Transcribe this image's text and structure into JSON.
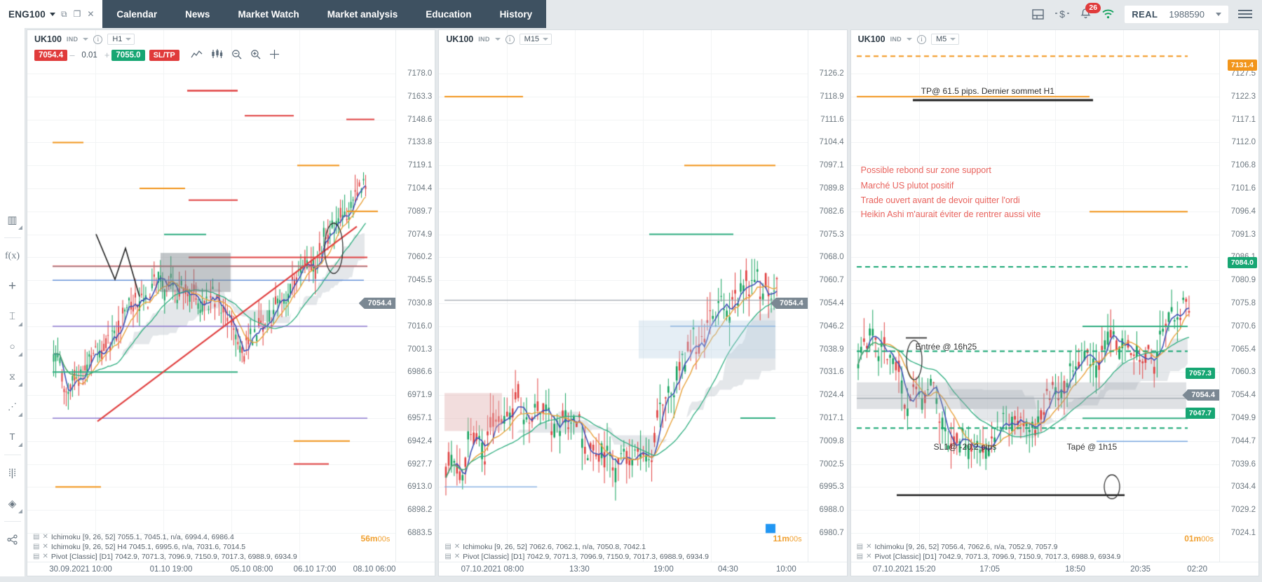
{
  "topbar": {
    "symbol_tab": "ENG100",
    "window_icons": [
      "restore-icon",
      "maximize-icon",
      "close-icon"
    ],
    "nav": [
      {
        "label": "Calendar",
        "name": "nav-calendar"
      },
      {
        "label": "News",
        "name": "nav-news"
      },
      {
        "label": "Market Watch",
        "name": "nav-market-watch"
      },
      {
        "label": "Market analysis",
        "name": "nav-market-analysis"
      },
      {
        "label": "Education",
        "name": "nav-education"
      },
      {
        "label": "History",
        "name": "nav-history"
      }
    ],
    "notification_count": "26",
    "account_type": "REAL",
    "account_number": "1988590"
  },
  "left_tools": [
    {
      "name": "indicators-bars-icon",
      "glyph": "▥"
    },
    {
      "name": "function-icon",
      "glyph": "f(x)"
    },
    {
      "name": "add-plus-icon",
      "glyph": "+"
    },
    {
      "name": "vertical-line-icon",
      "glyph": "⌶"
    },
    {
      "name": "circle-shape-icon",
      "glyph": "○"
    },
    {
      "name": "fibonacci-icon",
      "glyph": "⧖"
    },
    {
      "name": "pitchfork-icon",
      "glyph": "⋰"
    },
    {
      "name": "text-tool-icon",
      "glyph": "T"
    },
    {
      "name": "candle-type-icon",
      "glyph": "⦙"
    },
    {
      "name": "layers-icon",
      "glyph": "◈"
    },
    {
      "name": "share-icon",
      "glyph": "⦝"
    }
  ],
  "charts": [
    {
      "name": "chart-h1",
      "symbol": "UK100",
      "ind_label": "IND",
      "timeframe": "H1",
      "order": {
        "bid": "7054.4",
        "volume": "0.01",
        "ask": "7055.0",
        "sltp": "SL/TP",
        "minus": "–",
        "plus": "+"
      },
      "toolbar_icons": [
        "line-chart-icon",
        "candles-icon",
        "zoom-out-icon",
        "zoom-in-icon",
        "crosshair-icon"
      ],
      "y_ticks": [
        "7178.0",
        "7163.3",
        "7148.6",
        "7133.8",
        "7119.1",
        "7104.4",
        "7089.7",
        "7074.9",
        "7060.2",
        "7045.5",
        "7030.8",
        "7016.0",
        "7001.3",
        "6986.6",
        "6971.9",
        "6957.1",
        "6942.4",
        "6927.7",
        "6913.0",
        "6898.2",
        "6883.5"
      ],
      "current_price": "7054.4",
      "time_ticks": [
        "30.09.2021 10:00",
        "01.10 19:00",
        "05.10 08:00",
        "06.10 17:00",
        "08.10 06:00"
      ],
      "countdown_min": "56m",
      "countdown_sec": "00s",
      "legend": [
        "Ichimoku [9, 26, 52] 7055.1, 7045.1, n/a, 6994.4, 6986.4",
        "Ichimoku [9, 26, 52] H4 7045.1, 6995.6, n/a, 7031.6, 7014.5",
        "Pivot [Classic] [D1] 7042.9, 7071.3, 7096.9, 7150.9, 7017.3, 6988.9, 6934.9"
      ]
    },
    {
      "name": "chart-m15",
      "symbol": "UK100",
      "ind_label": "IND",
      "timeframe": "M15",
      "y_ticks": [
        "7126.2",
        "7118.9",
        "7111.6",
        "7104.4",
        "7097.1",
        "7089.8",
        "7082.6",
        "7075.3",
        "7068.0",
        "7060.7",
        "7054.4",
        "7046.2",
        "7038.9",
        "7031.6",
        "7024.4",
        "7017.1",
        "7009.8",
        "7002.5",
        "6995.3",
        "6988.0",
        "6980.7"
      ],
      "current_price": "7054.4",
      "low_price": "6980.7",
      "time_ticks": [
        "07.10.2021 08:00",
        "13:30",
        "19:00",
        "04:30",
        "10:00"
      ],
      "countdown_min": "11m",
      "countdown_sec": "00s",
      "legend": [
        "Ichimoku [9, 26, 52] 7062.6, 7062.1, n/a, 7050.8, 7042.1",
        "Pivot [Classic] [D1] 7042.9, 7071.3, 7096.9, 7150.9, 7017.3, 6988.9, 6934.9"
      ]
    },
    {
      "name": "chart-m5",
      "symbol": "UK100",
      "ind_label": "IND",
      "timeframe": "M5",
      "y_ticks": [
        "7127.5",
        "7122.3",
        "7117.1",
        "7112.0",
        "7106.8",
        "7101.6",
        "7096.4",
        "7091.3",
        "7086.1",
        "7080.9",
        "7075.8",
        "7070.6",
        "7065.4",
        "7060.3",
        "7054.4",
        "7049.9",
        "7044.7",
        "7039.6",
        "7034.4",
        "7029.2",
        "7024.1"
      ],
      "current_price": "7054.4",
      "badges": [
        {
          "label": "7131.4",
          "color": "#f2951b",
          "name": "tp-badge"
        },
        {
          "label": "7084.0",
          "color": "#17a673",
          "name": "level-badge-7084"
        },
        {
          "label": "7057.3",
          "color": "#17a673",
          "name": "level-badge-7057"
        },
        {
          "label": "7047.7",
          "color": "#17a673",
          "name": "level-badge-7047"
        }
      ],
      "annotations": [
        {
          "text": "TP@ 61.5 pips. Dernier sommet H1",
          "name": "annotation-tp",
          "color": "#333"
        },
        {
          "text": "Possible rebond sur zone support",
          "name": "annotation-rebond",
          "color": "#e8625c"
        },
        {
          "text": " Marché US plutot positif",
          "name": "annotation-marche-us",
          "color": "#e8625c"
        },
        {
          "text": "Trade ouvert avant de devoir quitter l'ordi",
          "name": "annotation-trade-ouvert",
          "color": "#e8625c"
        },
        {
          "text": "Heikin Ashi m'aurait éviter de rentrer aussi vite",
          "name": "annotation-heikin-ashi",
          "color": "#e8625c"
        },
        {
          "text": "Entrée @ 16h25",
          "name": "annotation-entree",
          "color": "#333"
        },
        {
          "text": "SL1@ -20.2 pips",
          "name": "annotation-sl1",
          "color": "#333"
        },
        {
          "text": "Tapé @ 1h15",
          "name": "annotation-tape",
          "color": "#333"
        }
      ],
      "time_ticks": [
        "07.10.2021 15:20",
        "17:05",
        "18:50",
        "20:35",
        "02:20"
      ],
      "countdown_min": "01m",
      "countdown_sec": "00s",
      "legend": [
        "Ichimoku [9, 26, 52] 7056.4, 7062.6, n/a, 7052.9, 7057.9",
        "Pivot [Classic] [D1] 7042.9, 7071.3, 7096.9, 7150.9, 7017.3, 6988.9, 6934.9"
      ]
    }
  ],
  "colors": {
    "nav_bg": "#3e5161",
    "bull": "#16a35f",
    "bear": "#e04040",
    "accent_orange": "#f2951b",
    "accent_green": "#17a673",
    "annotation_red": "#e8625c",
    "tenkan": "#3f51b5",
    "kijun": "#e8a33d",
    "cloud": "#c9ced6"
  }
}
